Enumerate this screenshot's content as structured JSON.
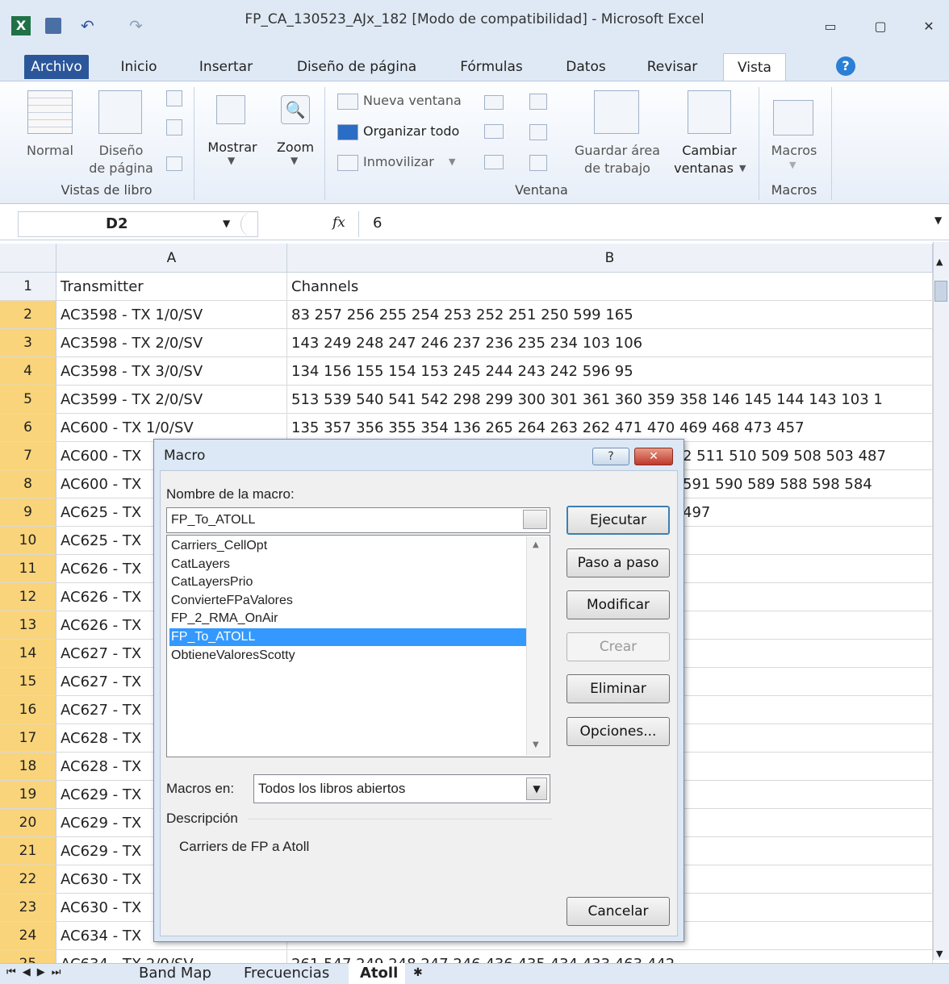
{
  "window": {
    "title": "FP_CA_130523_AJx_182  [Modo de compatibilidad]  -  Microsoft Excel"
  },
  "ribbon_tabs": [
    "Archivo",
    "Inicio",
    "Insertar",
    "Diseño de página",
    "Fórmulas",
    "Datos",
    "Revisar",
    "Vista"
  ],
  "ribbon": {
    "vistas_group": "Vistas de libro",
    "normal": "Normal",
    "diseno": "Diseño",
    "de_pagina": "de página",
    "mostrar": "Mostrar",
    "zoom": "Zoom",
    "nueva_ventana": "Nueva ventana",
    "organizar_todo": "Organizar todo",
    "inmovilizar": "Inmovilizar",
    "guardar_area": "Guardar área",
    "de_trabajo": "de trabajo",
    "cambiar": "Cambiar",
    "ventanas": "ventanas",
    "ventana_group": "Ventana",
    "macros": "Macros",
    "macros_group": "Macros"
  },
  "formula_bar": {
    "name_box": "D2",
    "value": "6"
  },
  "columns": [
    "A",
    "B"
  ],
  "rows": [
    {
      "n": "1",
      "a": "Transmitter",
      "b": "Channels"
    },
    {
      "n": "2",
      "a": "AC3598 - TX 1/0/SV",
      "b": "83 257 256 255 254 253 252 251 250 599 165"
    },
    {
      "n": "3",
      "a": "AC3598 - TX 2/0/SV",
      "b": "143 249 248 247 246 237 236 235 234 103 106"
    },
    {
      "n": "4",
      "a": "AC3598 - TX 3/0/SV",
      "b": "134 156 155 154 153 245 244 243 242 596 95"
    },
    {
      "n": "5",
      "a": "AC3599 - TX 2/0/SV",
      "b": "513 539 540 541 542 298 299 300 301 361 360 359 358 146 145 144 143 103 1"
    },
    {
      "n": "6",
      "a": "AC600 - TX 1/0/SV",
      "b": "135 357 356 355 354 136 265 264 263 262 471 470 469 468 473 457"
    },
    {
      "n": "7",
      "a": "AC600 - TX",
      "b": "2 511 510 509 508 503 487"
    },
    {
      "n": "8",
      "a": "AC600 - TX",
      "b": "591 590 589 588 598 584"
    },
    {
      "n": "9",
      "a": "AC625 - TX",
      "b": "497"
    },
    {
      "n": "10",
      "a": "AC625 - TX",
      "b": ""
    },
    {
      "n": "11",
      "a": "AC626 - TX",
      "b": ""
    },
    {
      "n": "12",
      "a": "AC626 - TX",
      "b": ""
    },
    {
      "n": "13",
      "a": "AC626 - TX",
      "b": ""
    },
    {
      "n": "14",
      "a": "AC627 - TX",
      "b": ""
    },
    {
      "n": "15",
      "a": "AC627 - TX",
      "b": ""
    },
    {
      "n": "16",
      "a": "AC627 - TX",
      "b": ""
    },
    {
      "n": "17",
      "a": "AC628 - TX",
      "b": ""
    },
    {
      "n": "18",
      "a": "AC628 - TX",
      "b": ""
    },
    {
      "n": "19",
      "a": "AC629 - TX",
      "b": ""
    },
    {
      "n": "20",
      "a": "AC629 - TX",
      "b": ""
    },
    {
      "n": "21",
      "a": "AC629 - TX",
      "b": ""
    },
    {
      "n": "22",
      "a": "AC630 - TX",
      "b": ""
    },
    {
      "n": "23",
      "a": "AC630 - TX",
      "b": ""
    },
    {
      "n": "24",
      "a": "AC634 - TX",
      "b": ""
    },
    {
      "n": "25",
      "a": "AC634 - TX 2/0/SV",
      "b": "261 547 249 248 247 246 436 435 434 433 463 442"
    }
  ],
  "sheets": [
    "Band Map",
    "Frecuencias",
    "Atoll"
  ],
  "dialog": {
    "title": "Macro",
    "name_label": "Nombre de la macro:",
    "name_value": "FP_To_ATOLL",
    "macros": [
      "Carriers_CellOpt",
      "CatLayers",
      "CatLayersPrio",
      "ConvierteFPaValores",
      "FP_2_RMA_OnAir",
      "FP_To_ATOLL",
      "ObtieneValoresScotty"
    ],
    "selected_index": 5,
    "buttons": {
      "ejecutar": "Ejecutar",
      "paso": "Paso a paso",
      "modificar": "Modificar",
      "crear": "Crear",
      "eliminar": "Eliminar",
      "opciones": "Opciones...",
      "cancelar": "Cancelar"
    },
    "macros_en_label": "Macros en:",
    "macros_en_value": "Todos los libros abiertos",
    "descripcion_label": "Descripción",
    "descripcion_value": "Carriers de FP a Atoll"
  }
}
